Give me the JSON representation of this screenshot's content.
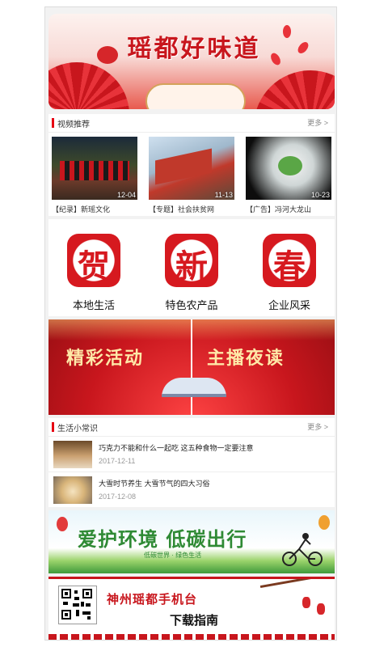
{
  "top_banner": {
    "title": "瑶都好味道"
  },
  "video_section": {
    "title": "视频推荐",
    "more": "更多 >",
    "items": [
      {
        "caption": "【纪录】新瑶文化",
        "date": "12-04"
      },
      {
        "caption": "【专题】社会扶贫网",
        "date": "11-13"
      },
      {
        "caption": "【广告】冯河大龙山",
        "date": "10-23"
      }
    ]
  },
  "quick_links": [
    {
      "glyph": "贺",
      "label": "本地生活"
    },
    {
      "glyph": "新",
      "label": "特色农产品"
    },
    {
      "glyph": "春",
      "label": "企业风采"
    }
  ],
  "activity_banner": {
    "left": "精彩活动",
    "right": "主播夜读"
  },
  "life_section": {
    "title": "生活小常识",
    "more": "更多 >",
    "items": [
      {
        "text": "巧克力不能和什么一起吃   这五种食物一定要注意",
        "date": "2017-12-11"
      },
      {
        "text": "大雪时节养生   大雪节气的四大习俗",
        "date": "2017-12-08"
      }
    ]
  },
  "env_banner": {
    "title": "爱护环境 低碳出行",
    "subtitle": "低碳世界 · 绿色生活"
  },
  "download_banner": {
    "line1": "神州瑶都手机台",
    "line2": "下载指南"
  },
  "colors": {
    "brand_red": "#c8161d",
    "accent_green": "#2f8a34"
  }
}
